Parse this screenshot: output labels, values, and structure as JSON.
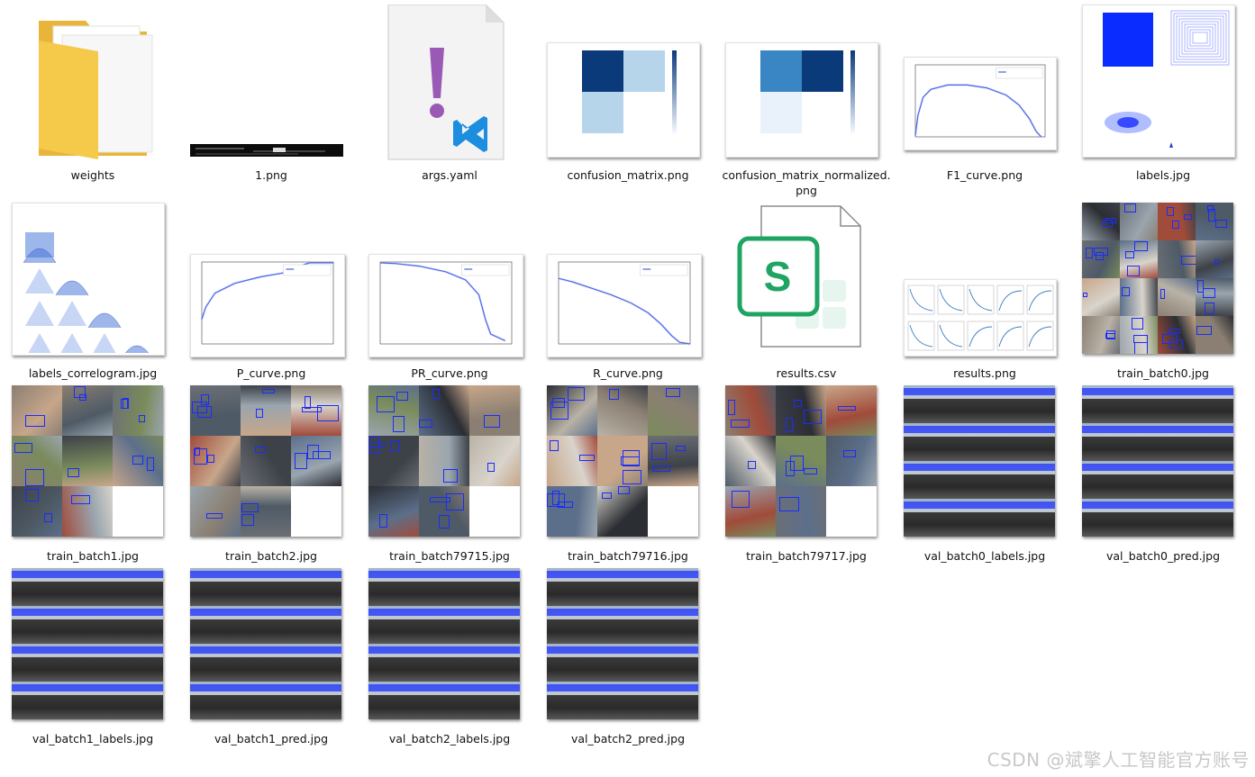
{
  "files": [
    {
      "name": "weights",
      "type": "folder"
    },
    {
      "name": "1.png",
      "type": "terminal-screenshot"
    },
    {
      "name": "args.yaml",
      "type": "yaml-file"
    },
    {
      "name": "confusion_matrix.png",
      "type": "confusion-matrix"
    },
    {
      "name": "confusion_matrix_normalized.png",
      "type": "confusion-matrix-normalized"
    },
    {
      "name": "F1_curve.png",
      "type": "curve"
    },
    {
      "name": "labels.jpg",
      "type": "labels-plot"
    },
    {
      "name": "labels_correlogram.jpg",
      "type": "correlogram"
    },
    {
      "name": "P_curve.png",
      "type": "curve"
    },
    {
      "name": "PR_curve.png",
      "type": "curve"
    },
    {
      "name": "R_curve.png",
      "type": "curve"
    },
    {
      "name": "results.csv",
      "type": "spreadsheet-file"
    },
    {
      "name": "results.png",
      "type": "results-grid"
    },
    {
      "name": "train_batch0.jpg",
      "type": "photo-mosaic"
    },
    {
      "name": "train_batch1.jpg",
      "type": "photo-mosaic"
    },
    {
      "name": "train_batch2.jpg",
      "type": "photo-mosaic"
    },
    {
      "name": "train_batch79715.jpg",
      "type": "photo-mosaic"
    },
    {
      "name": "train_batch79716.jpg",
      "type": "photo-mosaic"
    },
    {
      "name": "train_batch79717.jpg",
      "type": "photo-mosaic"
    },
    {
      "name": "val_batch0_labels.jpg",
      "type": "photo-mosaic"
    },
    {
      "name": "val_batch0_pred.jpg",
      "type": "photo-mosaic"
    },
    {
      "name": "val_batch1_labels.jpg",
      "type": "photo-mosaic"
    },
    {
      "name": "val_batch1_pred.jpg",
      "type": "photo-mosaic"
    },
    {
      "name": "val_batch2_labels.jpg",
      "type": "photo-mosaic"
    },
    {
      "name": "val_batch2_pred.jpg",
      "type": "photo-mosaic"
    }
  ],
  "icons": {
    "folder": "folder-icon",
    "yaml": "vscode-icon",
    "csv": "spreadsheet-icon"
  },
  "colors": {
    "folder": "#f5c94a",
    "yaml_exclaim": "#9b59b6",
    "vscode_blue": "#1c8ee0",
    "sheet_green": "#1fa463",
    "box_blue": "#1a2cff",
    "cm_dark": "#0a3a7a",
    "cm_light": "#b6d4ea",
    "curve_blue": "#2a3cd6"
  },
  "watermark": "CSDN @斌擎人工智能官方账号"
}
